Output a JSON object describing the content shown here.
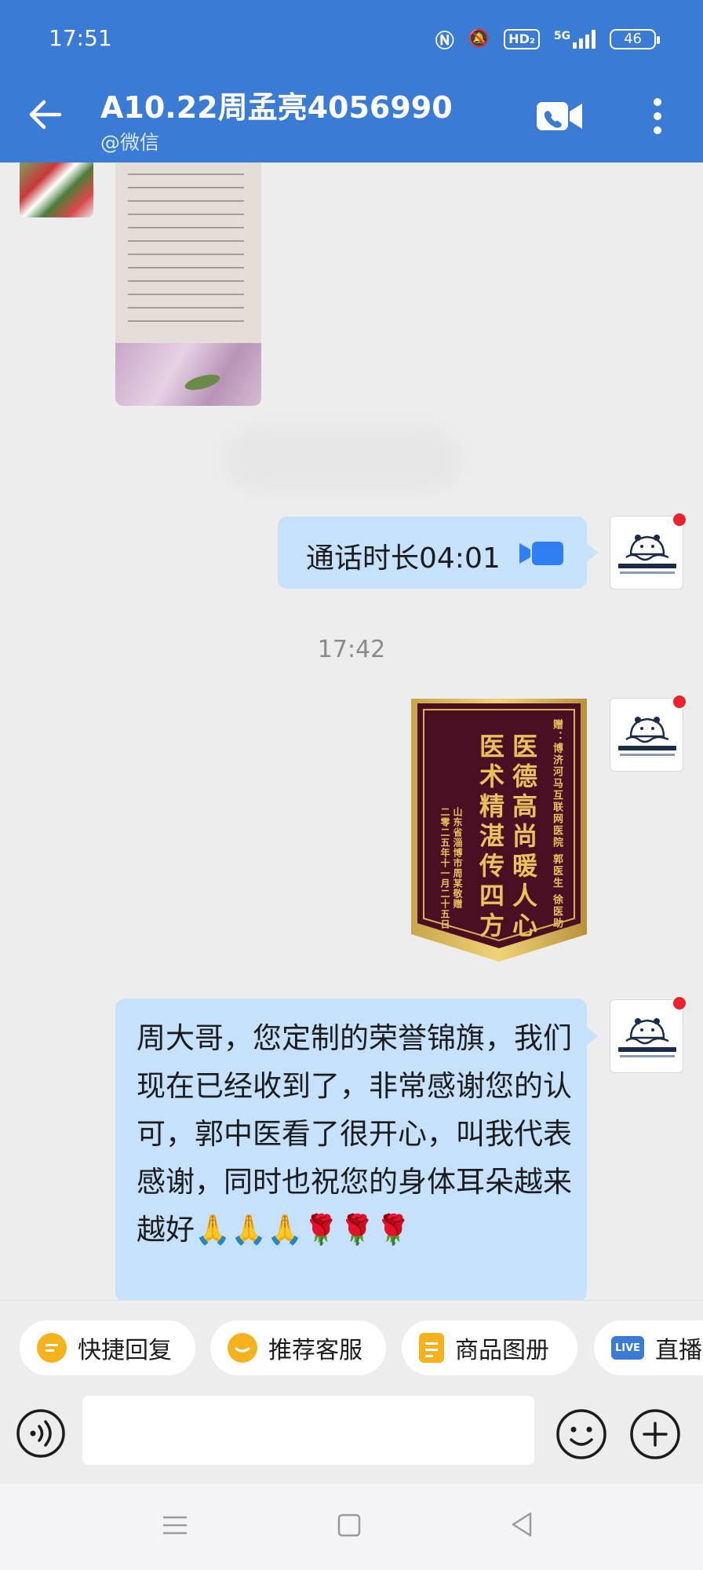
{
  "status_bar": {
    "time": "17:51",
    "network_label": "5G",
    "hd_label": "HD₂",
    "battery": "46"
  },
  "header": {
    "title": "A10.22周孟亮4056990",
    "subtitle": "@微信"
  },
  "messages": {
    "call_record": "通话时长04:01",
    "timestamp": "17:42",
    "banner": {
      "side_top": "赠：博济河马互联网医院 郭医生 徐医助",
      "main_right": "医德高尚暖人心",
      "main_left": "医术精湛传四方",
      "side_sender": "山东省淄博市周某敬赠",
      "side_date": "二零二五年十一月二十五日"
    },
    "reply_text": "周大哥，您定制的荣誉锦旗，我们现在已经收到了，非常感谢您的认可，郭中医看了很开心，叫我代表感谢，同时也祝您的身体耳朵越来越好🙏🙏🙏🌹🌹🌹"
  },
  "quick_replies": [
    {
      "label": "快捷回复",
      "icon": "quick-reply-icon",
      "color": "#f5b21d"
    },
    {
      "label": "推荐客服",
      "icon": "service-icon",
      "color": "#f5b21d"
    },
    {
      "label": "商品图册",
      "icon": "catalog-icon",
      "color": "#f5b21d"
    },
    {
      "label": "直播",
      "icon": "live-icon",
      "color": "#3a7bd5"
    }
  ],
  "live_badge": "LIVE",
  "input": {
    "value": ""
  },
  "colors": {
    "header": "#3a7bd5",
    "bubble": "#c6e1fb",
    "background": "#ededed"
  }
}
